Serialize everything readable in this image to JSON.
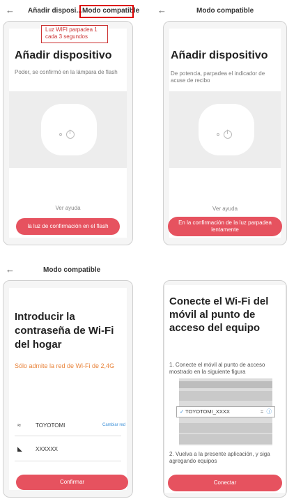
{
  "screens": [
    {
      "nav_title_prefix": "Añadir disposi...",
      "nav_title": "Modo compatible",
      "callout": "Luz WIFI parpadea 1\ncada 3 segundos",
      "heading": "Añadir dispositivo",
      "description": "Poder, se confirmó en la lámpara de flash",
      "help": "Ver ayuda",
      "button": "la luz de confirmación en el flash"
    },
    {
      "nav_title": "Modo compatible",
      "heading": "Añadir dispositivo",
      "description": "De potencia, parpadea el indicador de acuse de recibo",
      "help": "Ver ayuda",
      "button": "En la confirmación de la luz parpadea lentamente"
    },
    {
      "nav_title": "Modo compatible",
      "heading": "Introducir la contraseña de Wi-Fi del hogar",
      "note": "Sólo admite la red de Wi-Fi de 2,4G",
      "ssid": "TOYOTOMI",
      "change_network": "Cambiar red",
      "password": "XXXXXX",
      "button": "Confirmar"
    },
    {
      "heading": "Conecte el Wi-Fi del móvil al punto de acceso del equipo",
      "step1": "1. Conecte el móvil al punto de acceso mostrado en la siguiente figura",
      "selected_network": "TOYOTOMI_XXXX",
      "step2": "2. Vuelva a la presente aplicación, y siga agregando equipos",
      "button": "Conectar"
    }
  ],
  "colors": {
    "accent": "#e6525f",
    "orange": "#e8833a",
    "link": "#3a8fd8",
    "callout": "#cc3333"
  },
  "icons": [
    "back-arrow-icon",
    "power-icon",
    "wifi-icon",
    "lock-icon",
    "info-icon",
    "check-icon"
  ]
}
